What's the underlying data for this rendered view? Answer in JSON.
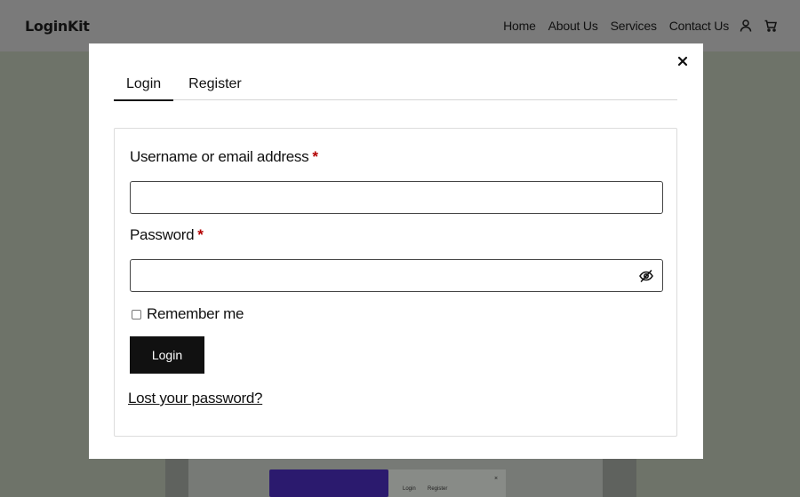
{
  "header": {
    "logo": "LoginKit",
    "nav": [
      "Home",
      "About Us",
      "Services",
      "Contact Us"
    ],
    "icons": [
      "user-icon",
      "cart-icon"
    ]
  },
  "modal": {
    "tabs": [
      {
        "label": "Login",
        "active": true
      },
      {
        "label": "Register",
        "active": false
      }
    ],
    "close_icon": "close-icon",
    "username_label": "Username or email address",
    "username_value": "",
    "password_label": "Password",
    "password_value": "",
    "required_mark": "*",
    "password_toggle_icon": "eye-slash-icon",
    "remember_label": "Remember me",
    "remember_checked": false,
    "login_button": "Login",
    "lost_password": "Lost your password?"
  },
  "background_preview": {
    "tabs": [
      "Login",
      "Register"
    ],
    "close": "×"
  }
}
